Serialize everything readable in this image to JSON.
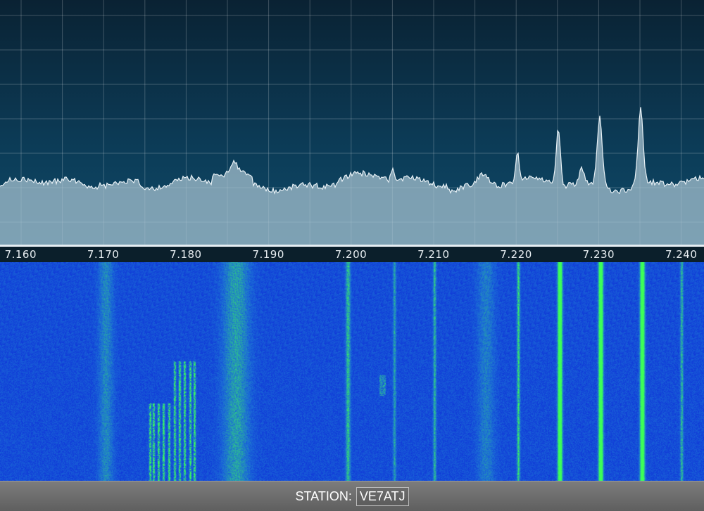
{
  "frequency_axis": {
    "ticks": [
      "7.160",
      "7.170",
      "7.180",
      "7.190",
      "7.200",
      "7.210",
      "7.220",
      "7.230",
      "7.240"
    ]
  },
  "spectrum": {
    "grid": true,
    "fill_color": "#a9c3d1",
    "peaks_mhz": [
      7.2195,
      7.2245,
      7.2295,
      7.2345
    ]
  },
  "waterfall": {
    "background_color": "#0d2bd2",
    "signal_color": "#3cff2a",
    "strong_signals_mhz": [
      7.2245,
      7.2295,
      7.2345
    ]
  },
  "status_bar": {
    "station_label": "STATION:",
    "station_value": "VE7ATJ"
  },
  "colors": {
    "spectrum_top": "#0a2233",
    "spectrum_bottom": "#0e4a69",
    "status_bar": "#6e6e6e"
  }
}
